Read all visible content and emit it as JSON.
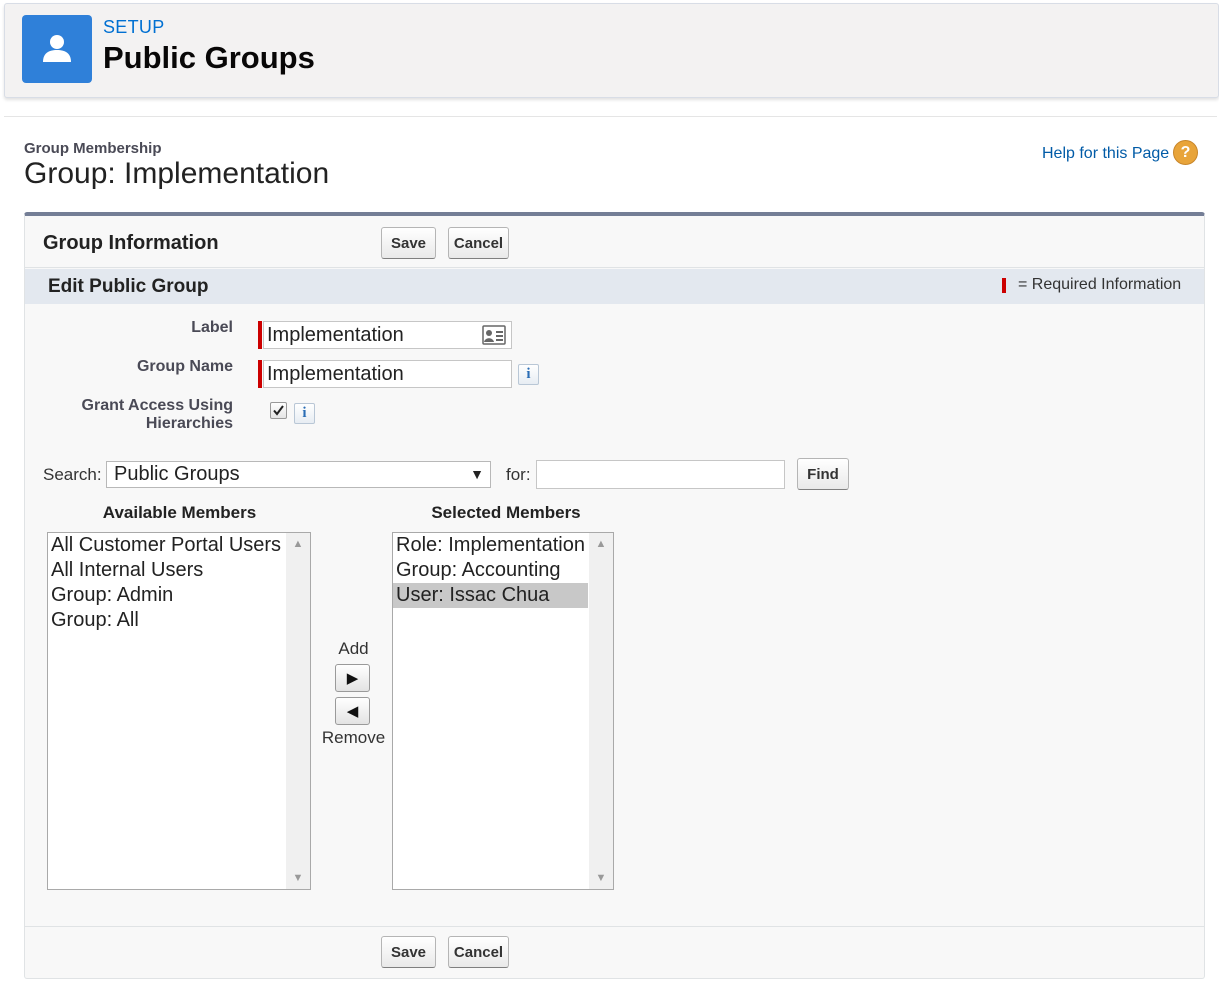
{
  "setup": {
    "eyebrow": "SETUP",
    "title": "Public Groups"
  },
  "page": {
    "eyebrow": "Group Membership",
    "title": "Group: Implementation",
    "help_link": "Help for this Page",
    "help_icon": "question-icon"
  },
  "block": {
    "title": "Group Information",
    "save_label": "Save",
    "cancel_label": "Cancel"
  },
  "section": {
    "title": "Edit Public Group",
    "required_text": "= Required Information",
    "required_color": "#cc0000"
  },
  "form": {
    "label_label": "Label",
    "label_value": "Implementation",
    "group_name_label": "Group Name",
    "group_name_value": "Implementation",
    "grant_access_label_line1": "Grant Access Using",
    "grant_access_label_line2": "Hierarchies",
    "grant_access_checked": true,
    "info_glyph": "i"
  },
  "search": {
    "label": "Search:",
    "selected_option": "Public Groups",
    "for_label": "for:",
    "for_value": "",
    "find_label": "Find"
  },
  "members": {
    "available_header": "Available Members",
    "selected_header": "Selected Members",
    "available": [
      "All Customer Portal Users",
      "All Internal Users",
      "Group: Admin",
      "Group: All"
    ],
    "selected": [
      "Role: Implementation",
      "Group: Accounting",
      "User: Issac Chua"
    ],
    "selected_highlight_index": 2,
    "add_label": "Add",
    "remove_label": "Remove"
  },
  "colors": {
    "accent": "#0070d2",
    "setup_icon_bg": "#2f80d9",
    "section_bar": "#e3e8ef"
  }
}
